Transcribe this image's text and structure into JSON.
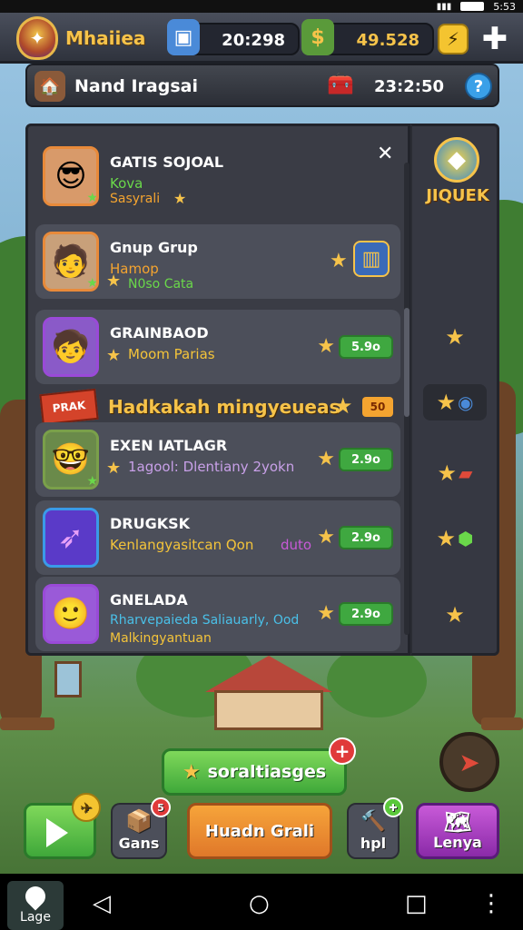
{
  "status_bar": {
    "time": "5:53"
  },
  "hud": {
    "player_name": "Mhaiiea",
    "resource1_value": "20:298",
    "resource2_value": "49.528",
    "resource1_icon": "blue-crate-icon",
    "resource2_icon": "money-bag-icon"
  },
  "subbar": {
    "title": "Nand Iragsai",
    "timer": "23:2:50",
    "help": "?"
  },
  "list": {
    "entries": [
      {
        "name": "GATIS SOJOAL",
        "line1": "Kova",
        "line2": "Sasyrali"
      },
      {
        "name": "Gnup Grup",
        "line1": "Hamop",
        "line2": "N0so Cata"
      },
      {
        "name": "GRAINBAOD",
        "line1": "Moom Parias",
        "pill": "5.9o"
      },
      {
        "name": "EXEN IATLAGR",
        "line1": "1agool: Dlentiany 2yokn",
        "pill": "2.9o"
      },
      {
        "name": "DRUGKSK",
        "line1": "Kenlangyasitcan Qon",
        "line1b": "duto",
        "pill": "2.9o"
      },
      {
        "name": "GNELADA",
        "line1": "Rharvepaieda Saliauarly, Ood",
        "line2": "Malkingyantuan",
        "pill": "2.9o"
      }
    ],
    "banner": {
      "flag": "PRAK",
      "text": "Hadkakah mingyeueas",
      "badge": "50"
    }
  },
  "side": {
    "title": "JIQUEK"
  },
  "bottom": {
    "main_button": "soraltiasges",
    "gans_label": "Gans",
    "center_label": "Huadn Grali",
    "hpl_label": "hpl",
    "lenya_label": "Lenya"
  },
  "navbar": {
    "home_label": "Lage"
  },
  "colors": {
    "gold": "#f6c34a",
    "green": "#3fa840",
    "orange": "#f4a430",
    "purple": "#8a2aa8"
  }
}
